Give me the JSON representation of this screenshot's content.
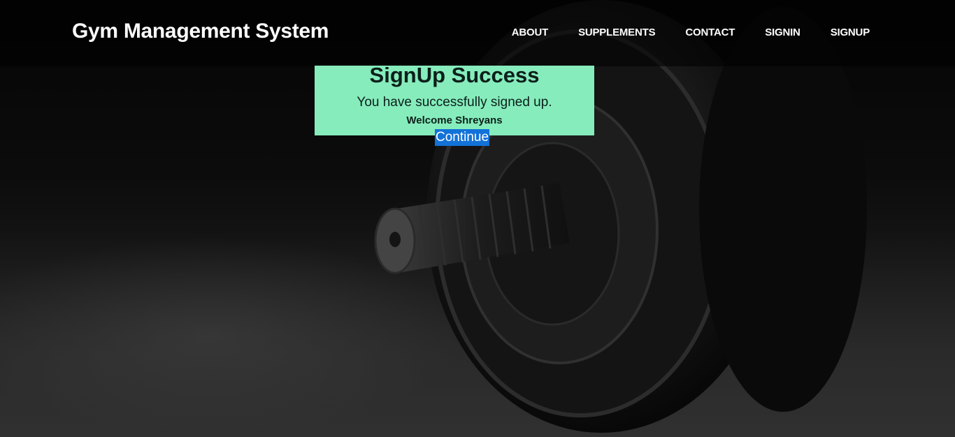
{
  "header": {
    "brand": "Gym Management System",
    "nav": [
      {
        "label": "ABOUT"
      },
      {
        "label": "SUPPLEMENTS"
      },
      {
        "label": "CONTACT"
      },
      {
        "label": "SIGNIN"
      },
      {
        "label": "SIGNUP"
      }
    ]
  },
  "success": {
    "title": "SignUp Success",
    "message": "You have successfully signed up.",
    "welcome": "Welcome Shreyans",
    "continue_label": "Continue"
  },
  "colors": {
    "success_bg": "#86ecbc",
    "link_highlight": "#1272d8",
    "header_text": "#ffffff"
  },
  "background": {
    "icon": "dumbbell-photo"
  }
}
